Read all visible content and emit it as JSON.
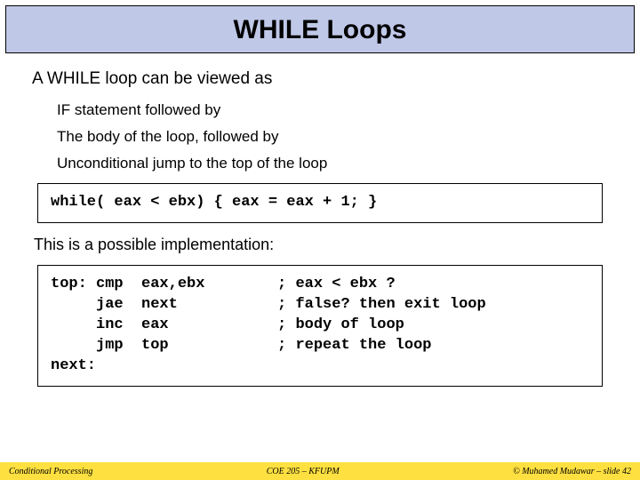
{
  "title": "WHILE Loops",
  "lead": "A WHILE loop can be viewed as",
  "bullets": [
    "IF statement followed by",
    "The body of the loop, followed by",
    "Unconditional jump to the top of the loop"
  ],
  "code_inline": "while( eax < ebx) { eax = eax + 1; }",
  "impl_text": "This is a possible implementation:",
  "code_asm": "top: cmp  eax,ebx        ; eax < ebx ?\n     jae  next           ; false? then exit loop\n     inc  eax            ; body of loop\n     jmp  top            ; repeat the loop\nnext:",
  "footer": {
    "left": "Conditional Processing",
    "center": "COE 205 – KFUPM",
    "right": "© Muhamed Mudawar – slide 42"
  }
}
